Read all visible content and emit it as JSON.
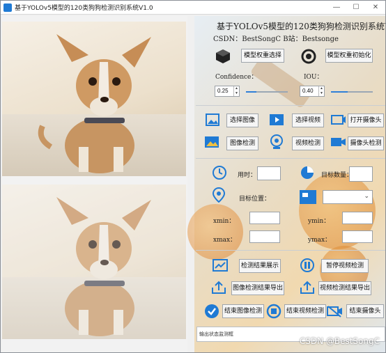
{
  "window": {
    "title": "基于YOLOv5模型的120类狗狗检测识别系统V1.0"
  },
  "header": {
    "title": "基于YOLOv5模型的120类狗狗检测识别系统V1.0",
    "subtitle": "CSDN：BestSongC   B站：Bestsonge"
  },
  "model": {
    "select_label": "模型权重选择",
    "init_label": "模型权重初始化"
  },
  "params": {
    "confidence_label": "Confidence：",
    "confidence_value": "0.25",
    "confidence_level": 0.25,
    "iou_label": "IOU：",
    "iou_value": "0.40",
    "iou_level": 0.4
  },
  "actions": {
    "select_image": "选择图像",
    "select_video": "选择视频",
    "open_camera": "打开摄像头",
    "image_detect": "图像检测",
    "video_detect": "视频检测",
    "camera_detect": "摄像头检测"
  },
  "info": {
    "time_label": "用时：",
    "count_label": "目标数量：",
    "position_label": "目标位置：",
    "xmin_label": "xmin：",
    "ymin_label": "ymin：",
    "xmax_label": "xmax：",
    "ymax_label": "ymax："
  },
  "results": {
    "show_result": "检测结果展示",
    "pause_video": "暂停视频检测",
    "export_image": "图像检测结果导出",
    "export_video": "视频检测结果导出",
    "end_image": "结束图像检测",
    "end_video": "结束视频检测",
    "end_camera": "结束摄像头"
  },
  "status": {
    "placeholder": "输出状态监测框"
  },
  "watermark": "CSDN @BestSongC",
  "colors": {
    "accent": "#1f7ad4"
  }
}
